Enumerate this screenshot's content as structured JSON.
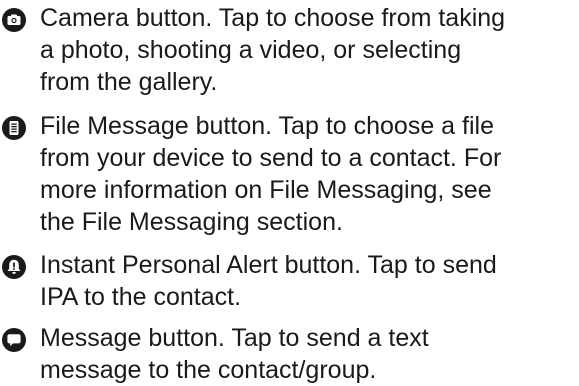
{
  "items": [
    {
      "icon": "camera-icon",
      "lines": [
        "Camera button. Tap to choose from taking",
        "a photo, shooting a video, or selecting",
        "from the gallery."
      ]
    },
    {
      "icon": "document-icon",
      "lines": [
        "File Message button. Tap to choose a file",
        "from your device to send to a contact. For",
        "more information on File Messaging, see",
        "the File Messaging section."
      ]
    },
    {
      "icon": "alert-icon",
      "lines": [
        "Instant Personal Alert button. Tap to send",
        "IPA to the contact."
      ]
    },
    {
      "icon": "speech-bubble-icon",
      "lines": [
        "Message button. Tap to send a text",
        "message to the contact/group."
      ]
    }
  ],
  "colors": {
    "icon": "#1a1a1a",
    "text": "#1a1a1a",
    "background": "#ffffff"
  }
}
